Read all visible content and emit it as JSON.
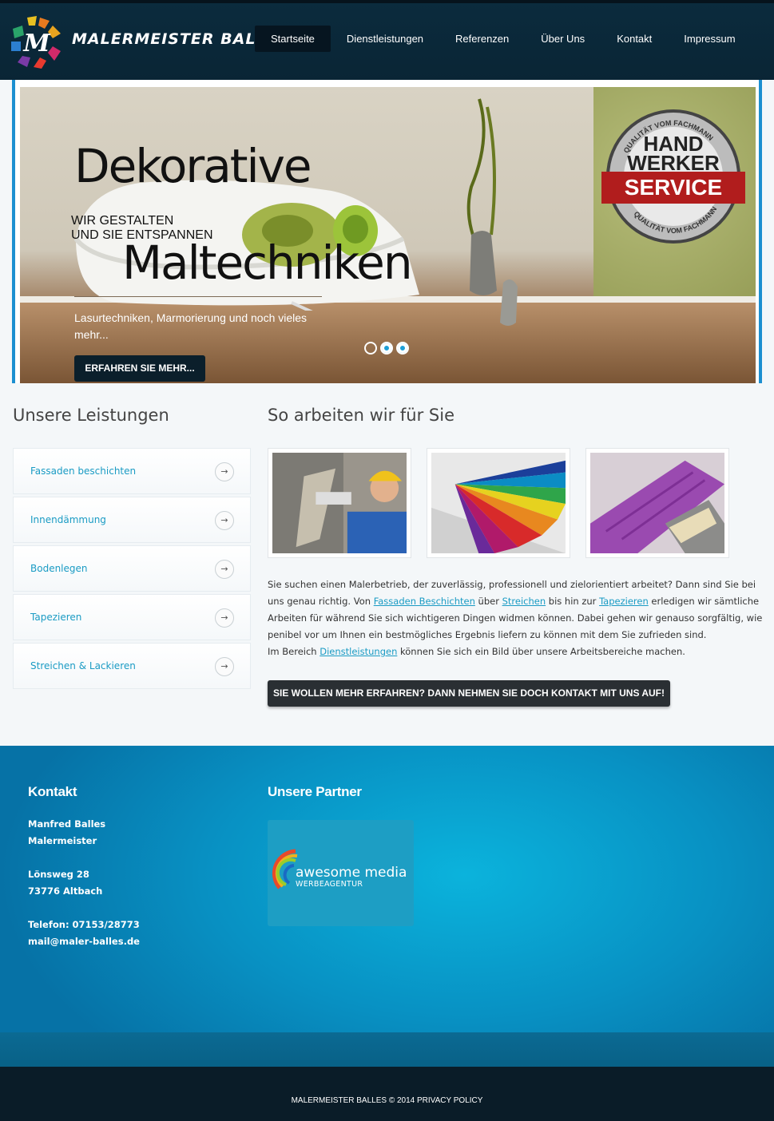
{
  "brand": {
    "name": "MALERMEISTER BALLES"
  },
  "nav": {
    "items": [
      {
        "label": "Startseite"
      },
      {
        "label": "Dienstleistungen"
      },
      {
        "label": "Referenzen"
      },
      {
        "label": "Über Uns"
      },
      {
        "label": "Kontakt"
      },
      {
        "label": "Impressum"
      }
    ],
    "active": "Startseite"
  },
  "slider": {
    "title_line1": "Dekorative",
    "subtitle_line1": "WIR GESTALTEN",
    "subtitle_line2": "UND SIE ENTSPANNEN",
    "title_line2": "Maltechniken",
    "description": "Lasurtechniken, Marmorierung und noch vieles mehr...",
    "button": "ERFAHREN SIE MEHR...",
    "badge": {
      "ring_top": "QUALITÄT VOM FACHMANN",
      "line1": "HAND",
      "line2": "WERKER",
      "line3": "SERVICE",
      "ring_bottom": "QUALITÄT VOM FACHMANN"
    }
  },
  "services": {
    "heading": "Unsere Leistungen",
    "items": [
      {
        "label": "Fassaden beschichten"
      },
      {
        "label": "Innendämmung"
      },
      {
        "label": "Bodenlegen"
      },
      {
        "label": "Tapezieren"
      },
      {
        "label": "Streichen & Lackieren"
      }
    ],
    "arrow": "→"
  },
  "work": {
    "heading": "So arbeiten wir für Sie",
    "paragraph": {
      "p1": "Sie suchen einen Malerbetrieb, der zuverlässig, professionell und zielorientiert arbeitet? Dann sind Sie bei uns genau richtig. Von ",
      "link1": "Fassaden Beschichten",
      "p2": " über ",
      "link2": "Streichen",
      "p3": " bis hin zur ",
      "link3": "Tapezieren",
      "p4": " erledigen wir sämtliche Arbeiten für während Sie sich wichtigeren Dingen widmen können. Dabei gehen wir genauso sorgfältig, wie penibel vor um Ihnen ein bestmögliches Ergebnis liefern zu können mit dem Sie zufrieden sind.",
      "p5": "Im Bereich ",
      "link4": "Dienstleistungen",
      "p6": " können Sie sich ein Bild über unsere Arbeitsbereiche machen."
    },
    "cta": "SIE WOLLEN MEHR ERFAHREN? DANN NEHMEN SIE DOCH KONTAKT MIT UNS AUF!"
  },
  "footer": {
    "contact_heading": "Kontakt",
    "name": "Manfred Balles",
    "role": "Malermeister",
    "street": "Lönsweg 28",
    "city": "73776 Altbach",
    "phone": "Telefon:  07153/28773",
    "email": "mail@maler-balles.de",
    "partners_heading": "Unsere Partner",
    "partner_name": "awesome media",
    "partner_sub": "WERBEAGENTUR"
  },
  "bottom": {
    "copyright": "MALERMEISTER BALLES © 2014",
    "privacy": "PRIVACY POLICY"
  },
  "colors": {
    "accent": "#1a9bc4",
    "header_bg": "#0b2b3d",
    "footer_blue": "#0891c3",
    "bottom_bg": "#0a1c28"
  }
}
